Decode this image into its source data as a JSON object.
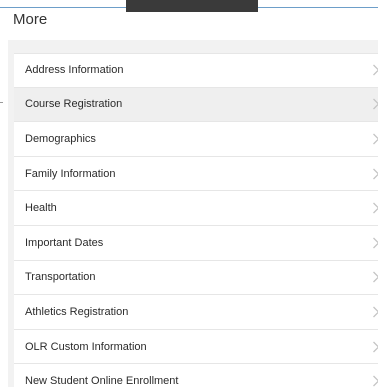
{
  "page": {
    "title": "More"
  },
  "menu": {
    "items": [
      {
        "label": "Address Information",
        "icon": "chevron-right-icon",
        "active": false
      },
      {
        "label": "Course Registration",
        "icon": "chevron-right-icon",
        "active": true
      },
      {
        "label": "Demographics",
        "icon": "chevron-right-icon",
        "active": false
      },
      {
        "label": "Family Information",
        "icon": "chevron-right-icon",
        "active": false
      },
      {
        "label": "Health",
        "icon": "chevron-right-icon",
        "active": false
      },
      {
        "label": "Important Dates",
        "icon": "chevron-right-icon",
        "active": false
      },
      {
        "label": "Transportation",
        "icon": "chevron-right-icon",
        "active": false
      },
      {
        "label": "Athletics Registration",
        "icon": "chevron-right-icon",
        "active": false
      },
      {
        "label": "OLR Custom Information",
        "icon": "chevron-right-icon",
        "active": false
      },
      {
        "label": "New Student Online Enrollment",
        "icon": "chevron-right-icon",
        "active": false
      }
    ]
  },
  "colors": {
    "accent_line": "#6d9ec9",
    "panel_bg": "#f2f2f2",
    "active_row": "#efefef",
    "text": "#2b2b2b",
    "chevron": "#c4c4c4"
  }
}
